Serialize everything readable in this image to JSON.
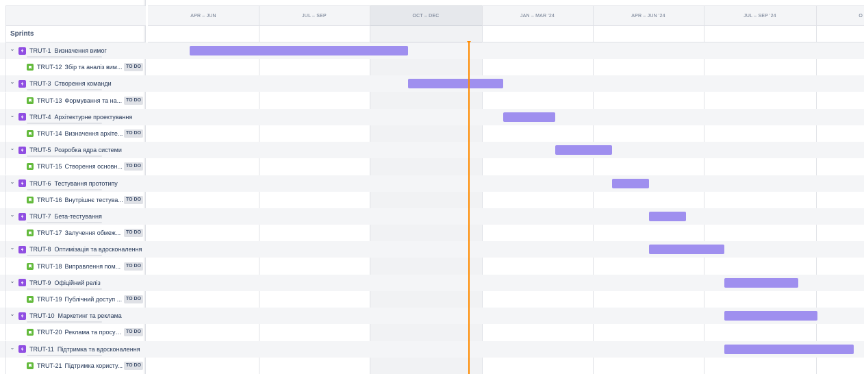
{
  "left_header": {
    "sprints_label": "Sprints"
  },
  "timeline": {
    "quarters": [
      "APR – JUN",
      "JUL – SEP",
      "OCT – DEC",
      "JAN – MAR '24",
      "APR – JUN '24",
      "JUL – SEP '24",
      "O"
    ],
    "current_quarter": "OCT – DEC"
  },
  "colors": {
    "bar": "#9f8fef",
    "today": "#ff8b00",
    "epic_icon": "#904ee2",
    "story_icon": "#63ba3c"
  },
  "epics": [
    {
      "key": "TRUT-1",
      "title": "Визначення вимог",
      "story": {
        "key": "TRUT-12",
        "title": "Збір та аналіз вим...",
        "status": "TO DO"
      }
    },
    {
      "key": "TRUT-3",
      "title": "Створення команди",
      "story": {
        "key": "TRUT-13",
        "title": "Формування та на...",
        "status": "TO DO"
      }
    },
    {
      "key": "TRUT-4",
      "title": "Архітектурне проектування",
      "story": {
        "key": "TRUT-14",
        "title": "Визначення архіте...",
        "status": "TO DO"
      }
    },
    {
      "key": "TRUT-5",
      "title": "Розробка ядра системи",
      "story": {
        "key": "TRUT-15",
        "title": "Створення основн...",
        "status": "TO DO"
      }
    },
    {
      "key": "TRUT-6",
      "title": "Тестування прототипу",
      "story": {
        "key": "TRUT-16",
        "title": "Внутрішнє тестува...",
        "status": "TO DO"
      }
    },
    {
      "key": "TRUT-7",
      "title": "Бета-тестування",
      "story": {
        "key": "TRUT-17",
        "title": "Залучення обмеж...",
        "status": "TO DO"
      }
    },
    {
      "key": "TRUT-8",
      "title": "Оптимізація та вдосконалення",
      "story": {
        "key": "TRUT-18",
        "title": "Виправлення пом...",
        "status": "TO DO"
      }
    },
    {
      "key": "TRUT-9",
      "title": "Офіційний реліз",
      "story": {
        "key": "TRUT-19",
        "title": "Публічний доступ ...",
        "status": "TO DO"
      }
    },
    {
      "key": "TRUT-10",
      "title": "Маркетинг та реклама",
      "story": {
        "key": "TRUT-20",
        "title": "Реклама та просув...",
        "status": "TO DO"
      }
    },
    {
      "key": "TRUT-11",
      "title": "Підтримка та вдосконалення",
      "story": {
        "key": "TRUT-21",
        "title": "Підтримка користу...",
        "status": "TO DO"
      }
    }
  ]
}
